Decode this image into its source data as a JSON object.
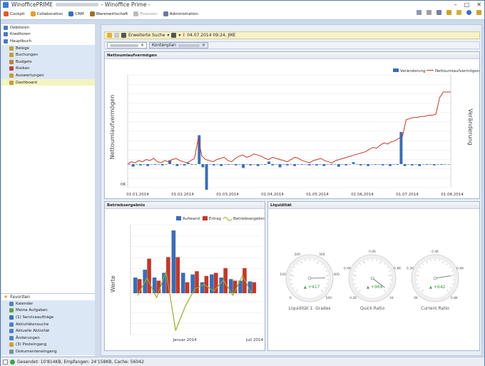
{
  "window": {
    "title_app": "WinofficePRIME",
    "title_suffix": "- Winoffice Prime -"
  },
  "menu": [
    {
      "label": "Cockpit",
      "color": "#e05a2a",
      "disabled": false
    },
    {
      "label": "Collaboration",
      "color": "#e0a02a",
      "disabled": false
    },
    {
      "label": "CRM",
      "color": "#3a6fc0",
      "disabled": false
    },
    {
      "label": "Warenwirtschaft",
      "color": "#a0702a",
      "disabled": false
    },
    {
      "label": "Finanzen",
      "color": "#bbbbbb",
      "disabled": true
    },
    {
      "label": "Administration",
      "color": "#6a7aa0",
      "disabled": false
    }
  ],
  "sidebar": {
    "items": [
      {
        "label": "Debitoren",
        "sub": false,
        "sel": false,
        "color": "#4a7ac0"
      },
      {
        "label": "Kreditoren",
        "sub": false,
        "sel": false,
        "color": "#4a7ac0"
      },
      {
        "label": "Hauptbuch",
        "sub": false,
        "sel": false,
        "color": "#4a7ac0"
      },
      {
        "label": "Belege",
        "sub": true,
        "sel": false,
        "color": "#c0a040"
      },
      {
        "label": "Buchungen",
        "sub": true,
        "sel": false,
        "color": "#c0a040"
      },
      {
        "label": "Budgets",
        "sub": true,
        "sel": false,
        "color": "#c08040"
      },
      {
        "label": "Risiken",
        "sub": true,
        "sel": false,
        "color": "#c04040"
      },
      {
        "label": "Auswertungen",
        "sub": true,
        "sel": false,
        "color": "#c0a040"
      },
      {
        "label": "Dashboard",
        "sub": true,
        "sel": true,
        "color": "#c0a040"
      }
    ],
    "favorites_title": "Favoriten",
    "favorites": [
      "Kalender",
      "Meine Aufgaben",
      "(1) Serviceaufträge",
      "Aktivitätensuche",
      "Aktuelle Aktivität",
      "Änderungen",
      "(3) Posteingang",
      "Dokumenteneingang"
    ]
  },
  "toolbar": {
    "search_label": "Erweiterte Suche",
    "stamp": "04.07.2014 09:24, JME"
  },
  "tabs": {
    "tab2": "Kontenplan"
  },
  "panels": {
    "top_title": "Nettoumlaufvermögen",
    "left_title": "Betriebsergebnis",
    "right_title": "Liquidität"
  },
  "status": {
    "text": "Gesendet: 10'814KB, Empfangen: 24'158KB, Cache: 56042"
  },
  "chart_data": [
    {
      "type": "bar+line",
      "title": "Nettoumlaufvermögen",
      "ylabel": "Nettoumlaufvermögen",
      "y2label": "Veränderung",
      "ytick_label": "0K",
      "legend": [
        "Veränderung",
        "Nettoumlaufvermögen"
      ],
      "legend_position": "top-right",
      "x_labels": [
        "01.01.2014",
        "01.02.2014",
        "01.03.2014",
        "01.04.2014",
        "01.05.2014",
        "01.06.2014",
        "01.07.2014",
        "01.08.2014"
      ],
      "colors": {
        "bar": "#3b6db5",
        "line": "#c0392b"
      },
      "line_values": [
        55,
        57,
        56,
        58,
        57,
        59,
        58,
        60,
        57,
        56,
        58,
        57,
        59,
        60,
        58,
        57,
        56,
        58,
        60,
        78,
        62,
        59,
        58,
        57,
        59,
        60,
        61,
        58,
        57,
        60,
        62,
        63,
        61,
        62,
        64,
        63,
        62,
        60,
        59,
        61,
        60,
        59,
        58,
        57,
        59,
        61,
        60,
        58,
        57,
        56,
        58,
        59,
        60,
        58,
        57,
        56,
        58,
        59,
        60,
        61,
        62,
        63,
        64,
        65,
        66,
        68,
        70,
        69,
        72,
        74,
        73,
        75,
        76,
        78,
        80,
        95,
        96,
        97,
        97,
        98,
        98,
        99,
        99,
        100,
        115,
        120,
        120,
        120
      ],
      "bar_values": [
        0,
        -4,
        0,
        -2,
        0,
        -3,
        0,
        -1,
        0,
        -2,
        0,
        6,
        0,
        -3,
        0,
        -2,
        2,
        -1,
        0,
        45,
        -5,
        -40,
        0,
        -2,
        0,
        -3,
        0,
        -1,
        0,
        -2,
        0,
        -6,
        0,
        -2,
        0,
        -3,
        0,
        -1,
        4,
        -2,
        0,
        -5,
        0,
        -2,
        0,
        -3,
        0,
        -1,
        0,
        -2,
        0,
        -2,
        0,
        -3,
        0,
        -1,
        0,
        -4,
        0,
        -2,
        0,
        3,
        0,
        -2,
        0,
        -3,
        0,
        -1,
        0,
        -2,
        0,
        -3,
        0,
        -1,
        50,
        -3,
        0,
        -2,
        0,
        -3,
        0,
        -1,
        0,
        -2,
        0,
        -1,
        0,
        0
      ]
    },
    {
      "type": "bar+line",
      "title": "Betriebsergebnis",
      "ylabel": "Werte",
      "legend": [
        "Aufwand",
        "Ertrag",
        "Betriebsergebnis"
      ],
      "legend_position": "top-right",
      "x_labels": [
        "Januar 2014",
        "Juli 2014"
      ],
      "colors": {
        "aufwand": "#3b6db5",
        "ertrag": "#c0392b",
        "ergebnis": "#9aaa30"
      },
      "series": [
        {
          "name": "Aufwand",
          "values": [
            20,
            30,
            20,
            26,
            80,
            26,
            24,
            14,
            24,
            20,
            18,
            16,
            15
          ]
        },
        {
          "name": "Ertrag",
          "values": [
            18,
            44,
            16,
            46,
            46,
            14,
            28,
            22,
            26,
            32,
            16,
            32,
            14
          ]
        },
        {
          "name": "Betriebsergebnis",
          "values": [
            -2,
            14,
            -4,
            20,
            -34,
            -12,
            4,
            8,
            2,
            12,
            -2,
            16,
            -1
          ]
        }
      ]
    },
    {
      "type": "gauge",
      "title": "Liquidität",
      "gauges": [
        {
          "name": "Liquidität 1. Grades",
          "value_label": "+417",
          "ticks": [
            "0",
            "100",
            "200",
            "300",
            "400",
            "500"
          ],
          "pointer": 0.83
        },
        {
          "name": "Quick Ratio",
          "value_label": "+969",
          "ticks": [
            "0.2K",
            "0.4K",
            "0.6K",
            "0.8K",
            "1K"
          ],
          "pointer": 0.97
        },
        {
          "name": "Current Ratio",
          "value_label": "+642",
          "ticks": [
            "0K",
            "0.2K",
            "0.4K",
            "0.6K",
            "0.8K"
          ],
          "pointer": 0.8
        }
      ]
    }
  ]
}
